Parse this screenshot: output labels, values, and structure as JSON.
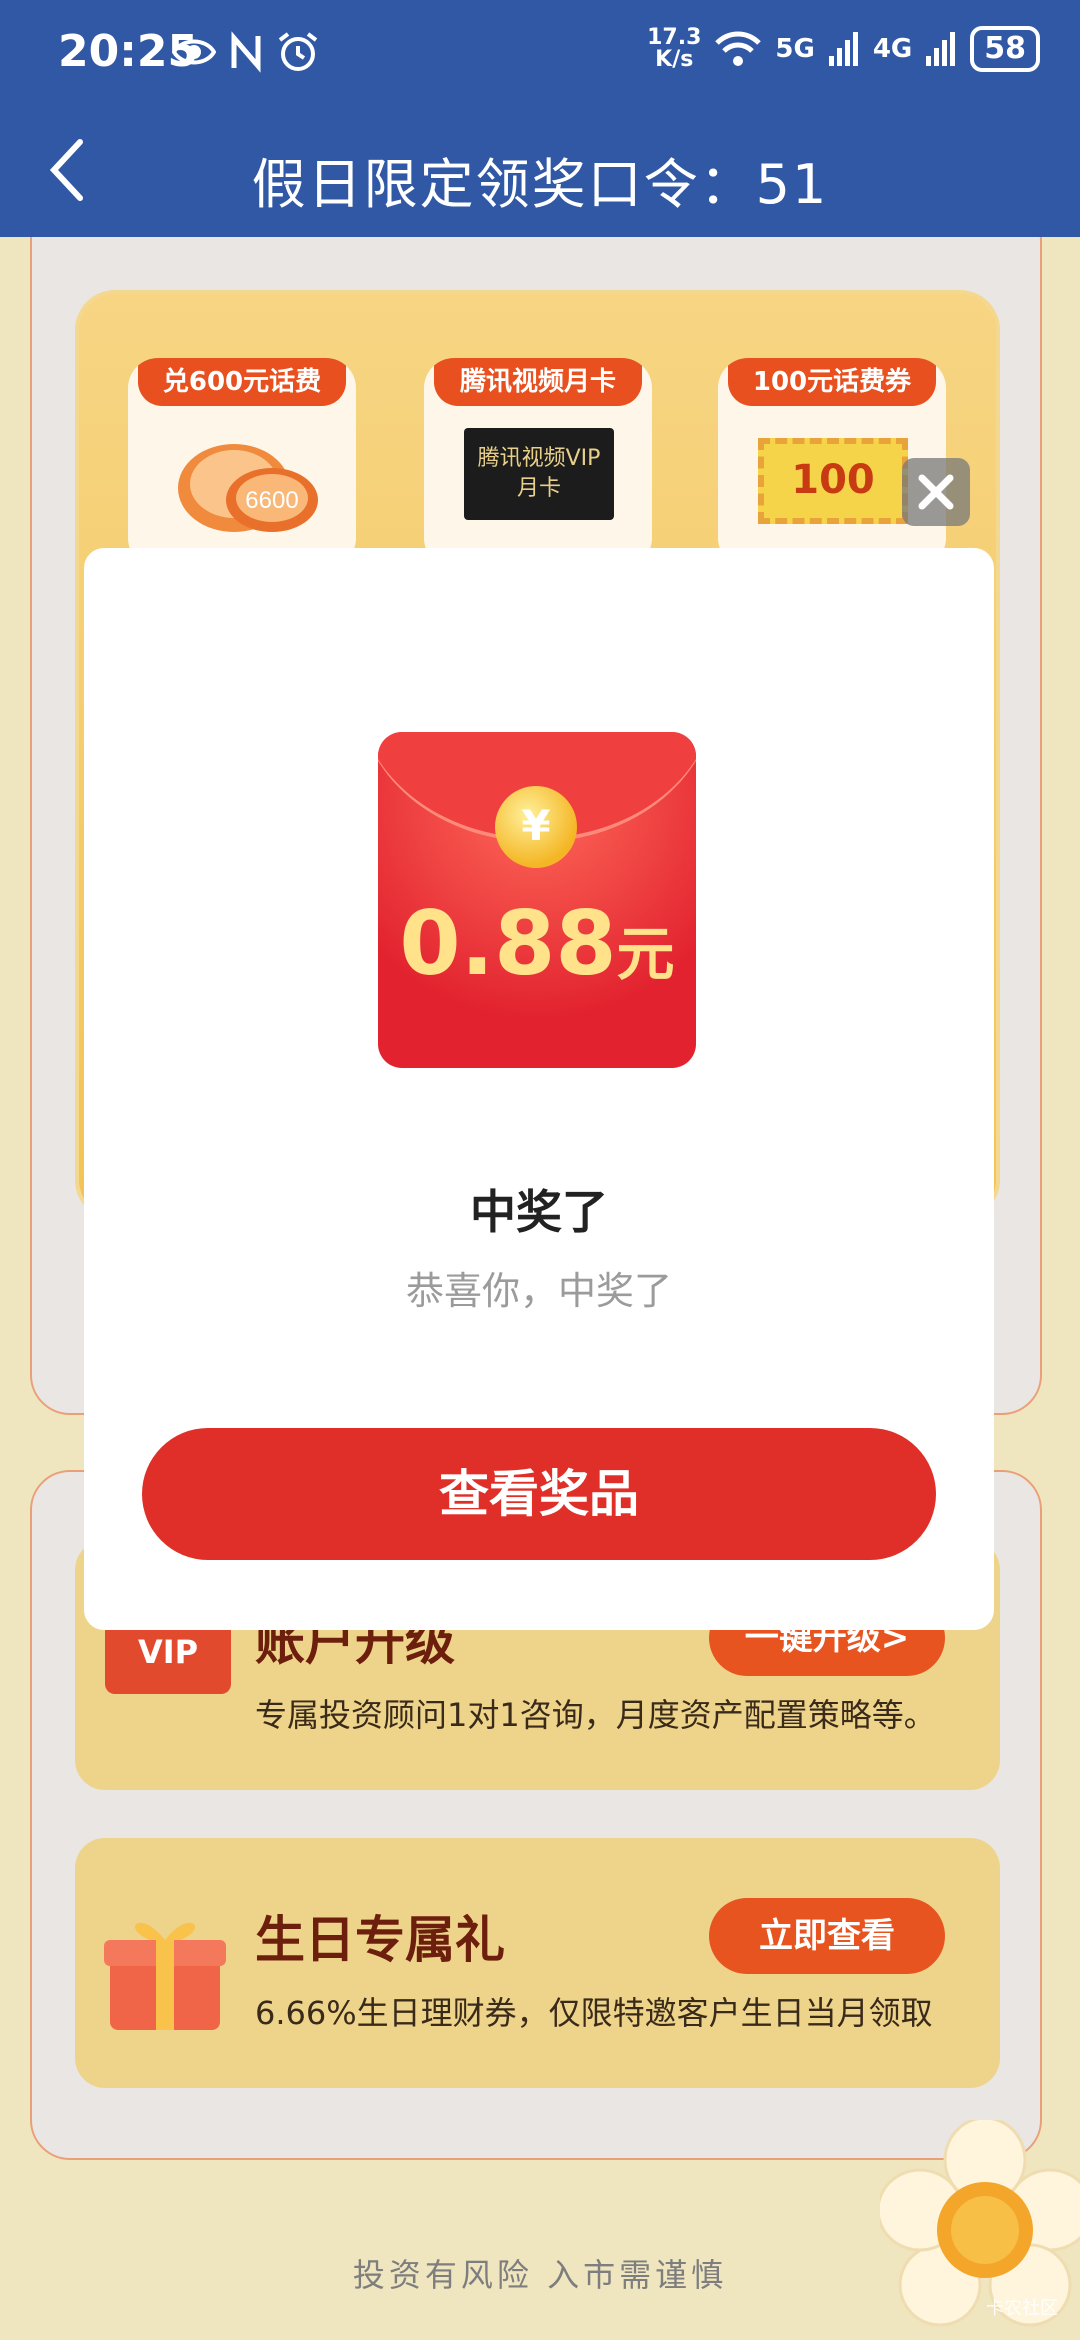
{
  "status_bar": {
    "time": "20:25",
    "speed_top": "17.3",
    "speed_bottom": "K/s",
    "sig_5g": "5G",
    "sig_4g": "4G",
    "battery": "58"
  },
  "nav": {
    "title": "假日限定领奖口令：51",
    "back_icon": "chevron-left-icon"
  },
  "prizes": [
    {
      "tag": "兑600元话费",
      "icon": "coin-icon",
      "badge": "6600"
    },
    {
      "tag": "腾讯视频月卡",
      "icon": "vip-card-icon",
      "card_line1": "腾讯视频VIP",
      "card_line2": "月卡"
    },
    {
      "tag": "100元话费券",
      "icon": "ticket-icon",
      "amount": "100"
    }
  ],
  "rows": [
    {
      "title": "账户升级",
      "desc": "专属投资顾问1对1咨询，月度资产配置策略等。",
      "button": "一键升级>",
      "badge": "VIP"
    },
    {
      "title": "生日专属礼",
      "desc": "6.66%生日理财券，仅限特邀客户生日当月领取",
      "button": "立即查看"
    }
  ],
  "footer": "投资有风险 入市需谨慎",
  "watermark": "卡农社区",
  "modal": {
    "amount": "0.88",
    "unit": "元",
    "currency": "¥",
    "title": "中奖了",
    "subtitle": "恭喜你，中奖了",
    "button": "查看奖品"
  },
  "colors": {
    "header": "#3158a5",
    "primary_red": "#df2f28",
    "orange": "#e8541f"
  }
}
